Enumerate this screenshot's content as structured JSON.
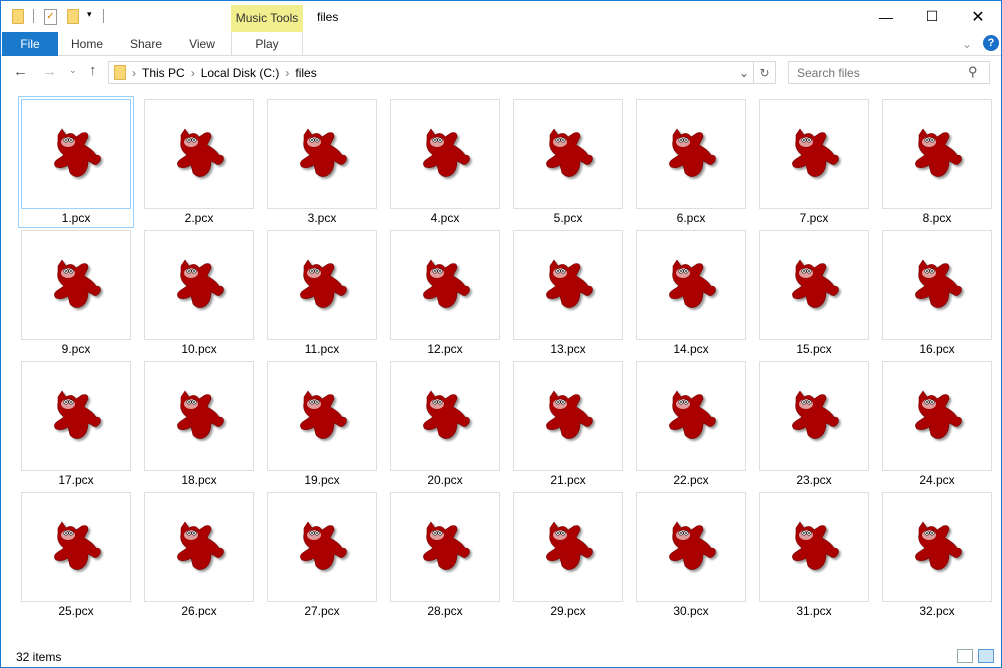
{
  "window": {
    "title": "files",
    "context_tab": "Music Tools"
  },
  "ribbon": {
    "tabs": [
      "File",
      "Home",
      "Share",
      "View"
    ],
    "context_subtab": "Play"
  },
  "address": {
    "crumbs": [
      "This PC",
      "Local Disk (C:)",
      "files"
    ]
  },
  "search": {
    "placeholder": "Search files"
  },
  "files": [
    "1.pcx",
    "2.pcx",
    "3.pcx",
    "4.pcx",
    "5.pcx",
    "6.pcx",
    "7.pcx",
    "8.pcx",
    "9.pcx",
    "10.pcx",
    "11.pcx",
    "12.pcx",
    "13.pcx",
    "14.pcx",
    "15.pcx",
    "16.pcx",
    "17.pcx",
    "18.pcx",
    "19.pcx",
    "20.pcx",
    "21.pcx",
    "22.pcx",
    "23.pcx",
    "24.pcx",
    "25.pcx",
    "26.pcx",
    "27.pcx",
    "28.pcx",
    "29.pcx",
    "30.pcx",
    "31.pcx",
    "32.pcx"
  ],
  "selected_file": "1.pcx",
  "status": {
    "count": "32 items"
  },
  "colors": {
    "accent": "#1979ca",
    "context": "#f1ef8d",
    "icon": "#aa0000"
  }
}
